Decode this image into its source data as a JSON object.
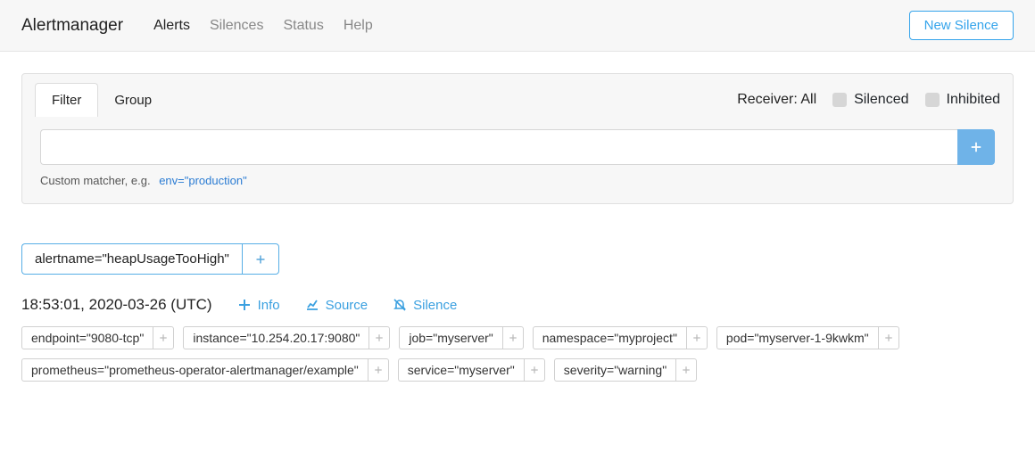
{
  "nav": {
    "brand": "Alertmanager",
    "links": [
      "Alerts",
      "Silences",
      "Status",
      "Help"
    ],
    "new_silence": "New Silence"
  },
  "filter_card": {
    "tabs": {
      "filter": "Filter",
      "group": "Group"
    },
    "receiver_label": "Receiver: All",
    "checkboxes": {
      "silenced": "Silenced",
      "inhibited": "Inhibited"
    },
    "hint_prefix": "Custom matcher, e.g.",
    "hint_example": "env=\"production\""
  },
  "group": {
    "label": "alertname=\"heapUsageTooHigh\""
  },
  "alert": {
    "timestamp": "18:53:01, 2020-03-26 (UTC)",
    "actions": {
      "info": "Info",
      "source": "Source",
      "silence": "Silence"
    },
    "labels": [
      "endpoint=\"9080-tcp\"",
      "instance=\"10.254.20.17:9080\"",
      "job=\"myserver\"",
      "namespace=\"myproject\"",
      "pod=\"myserver-1-9kwkm\"",
      "prometheus=\"prometheus-operator-alertmanager/example\"",
      "service=\"myserver\"",
      "severity=\"warning\""
    ]
  }
}
